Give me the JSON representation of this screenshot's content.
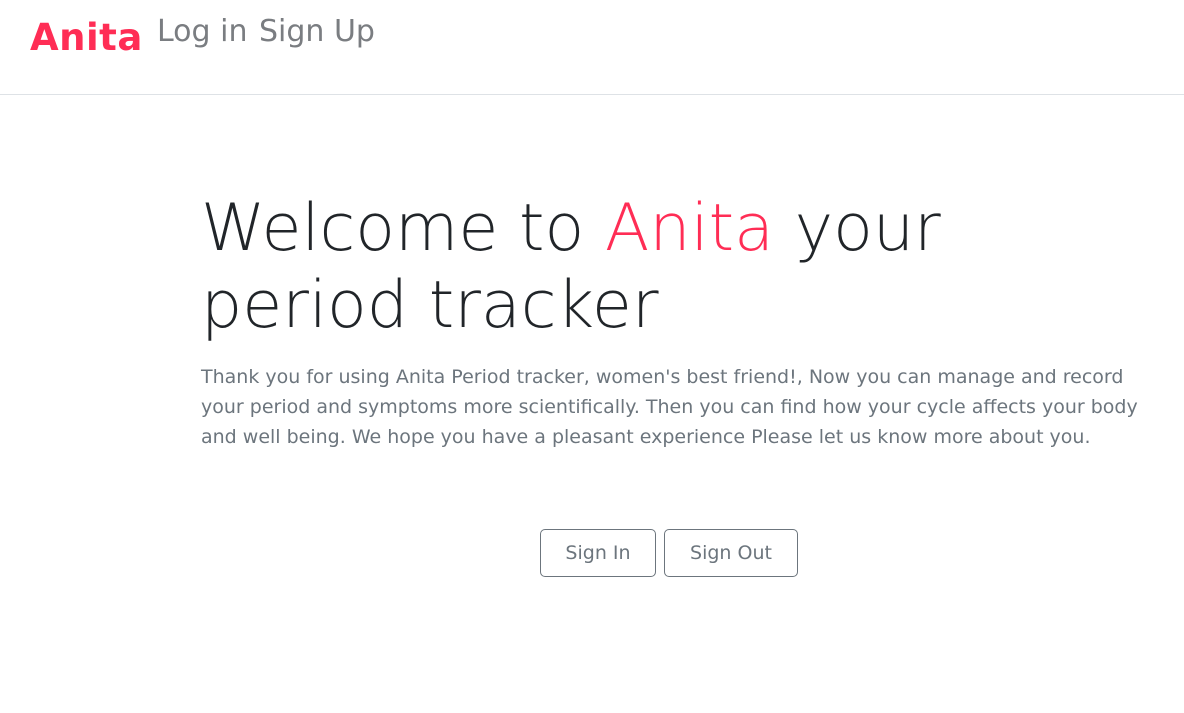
{
  "navbar": {
    "brand": "Anita",
    "links": [
      "Log in",
      "Sign Up"
    ]
  },
  "hero": {
    "title_prefix": "Welcome to ",
    "title_accent": "Anita",
    "title_suffix": " your period tracker",
    "description": "Thank you for using Anita Period tracker, women's best friend!, Now you can manage and record your period and symptoms more scientifically. Then you can find how your cycle affects your body and well being. We hope you have a pleasant experience Please let us know more about you."
  },
  "actions": {
    "sign_in": "Sign In",
    "sign_out": "Sign Out"
  },
  "colors": {
    "accent": "#ff2d55",
    "muted": "#6c757d",
    "heading": "#212529"
  }
}
